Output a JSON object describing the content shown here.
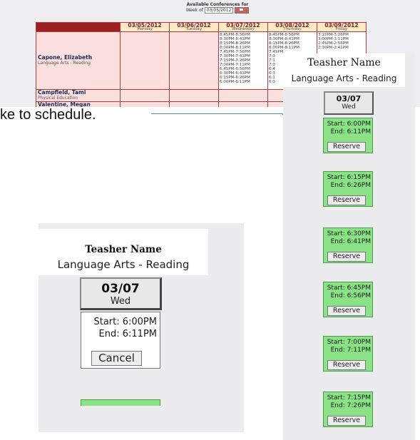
{
  "schedule": {
    "title": "Available Conferences for",
    "week_prefix": "Week of",
    "week_value": "03/05/2012",
    "days": [
      {
        "date": "03/05/2012",
        "day": "Monday"
      },
      {
        "date": "03/06/2012",
        "day": "Tuesday"
      },
      {
        "date": "03/07/2012",
        "day": "Wednesday"
      },
      {
        "date": "03/08/2012",
        "day": "Thursday"
      },
      {
        "date": "03/09/2012",
        "day": "Friday"
      }
    ],
    "teachers": [
      {
        "name": "Capone, Elizabeth",
        "subject": "Language Arts - Reading"
      },
      {
        "name": "Campfield, Tami",
        "subject": "Physical Education"
      },
      {
        "name": "Valentine, Megan",
        "subject": ""
      }
    ],
    "wednesday_times": [
      "8:45PM-8:56PM",
      "8:30PM-8:41PM",
      "8:15PM-8:26PM",
      "8:00PM-8:11PM",
      "7:45PM-7:56PM",
      "7:30PM-7:41PM",
      "7:15PM-7:26PM",
      "7:00PM-7:11PM",
      "6:45PM-6:56PM",
      "6:30PM-6:41PM",
      "6:15PM-6:26PM",
      "6:00PM-6:11PM"
    ],
    "thursday_times": [
      "8:45PM-8:56PM",
      "8:30PM-8:41PM",
      "8:15PM-8:26PM",
      "8:00PM-8:11PM",
      "7:45PM",
      "7:3",
      "7:1",
      "7:0",
      "6:4",
      "6:3",
      "6:1",
      "6:0"
    ],
    "friday_times": [
      "3:15PM-3:26PM",
      "3:00PM-3:11PM",
      "2:45PM-2:56PM",
      "2:30PM-2:41PM"
    ]
  },
  "instruction": "ke to schedule.",
  "reserve_panel": {
    "teacher_name": "Teasher Name",
    "subject": "Language Arts - Reading",
    "date": "03/07",
    "weekday": "Wed",
    "slots": [
      {
        "start": "Start: 6:00PM",
        "end": "End: 6:11PM",
        "button": "Reserve"
      },
      {
        "start": "Start: 6:15PM",
        "end": "End: 6:26PM",
        "button": "Reserve"
      },
      {
        "start": "Start: 6:30PM",
        "end": "End: 6:41PM",
        "button": "Reserve"
      },
      {
        "start": "Start: 6:45PM",
        "end": "End: 6:56PM",
        "button": "Reserve"
      },
      {
        "start": "Start: 7:00PM",
        "end": "End: 7:11PM",
        "button": "Reserve"
      },
      {
        "start": "Start: 7:15PM",
        "end": "End: 7:26PM",
        "button": "Reserve"
      }
    ]
  },
  "cancel_panel": {
    "teacher_name": "Teasher Name",
    "subject": "Language Arts - Reading",
    "date": "03/07",
    "weekday": "Wed",
    "start": "Start: 6:00PM",
    "end": "End: 6:11PM",
    "button": "Cancel"
  },
  "colors": {
    "slot_green": "#8ae286",
    "header_red": "#9e1f1f",
    "cell_pink": "#fce0e0",
    "arrow_blue": "#4f81bd"
  }
}
